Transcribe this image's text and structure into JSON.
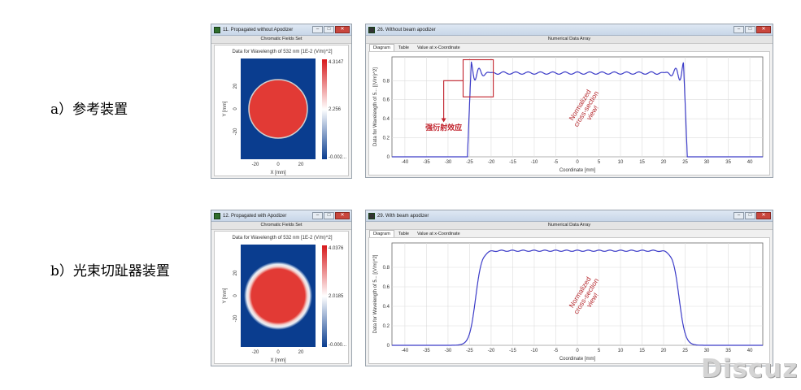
{
  "row_a": {
    "label": "a）参考装置",
    "field_window": {
      "title": "11. Propagated without Apodizer",
      "header": "Chromatic Fields Set",
      "caption": "Data for Wavelength of 532 nm  [1E-2 (V/m)^2]",
      "colorbar_max": "4.3147",
      "colorbar_mid": "2.256",
      "colorbar_min": "-0.002...",
      "xlabel": "X [mm]",
      "ylabel": "Y [mm]",
      "x_ticks": [
        "-20",
        "0",
        "20"
      ],
      "y_ticks": [
        "20",
        "0",
        "-20"
      ],
      "profile": "hard-edge"
    },
    "plot_window": {
      "title": "26. Without beam apodizer",
      "header": "Numerical Data Array",
      "tabs": [
        "Diagram",
        "Table",
        "Value at x-Coordinate"
      ],
      "ylabel": "Data for Wavelength of 5... [(V/m)^2]",
      "xlabel": "Coordinate [mm]",
      "annotation_text": "Normalized cross-section view!",
      "callout_label": "强衍射效应"
    }
  },
  "row_b": {
    "label": "b）光束切趾器装置",
    "field_window": {
      "title": "12. Propagated with Apodizer",
      "header": "Chromatic Fields Set",
      "caption": "Data for Wavelength of 532 nm  [1E-2 (V/m)^2]",
      "colorbar_max": "4.0376",
      "colorbar_mid": "2.0185",
      "colorbar_min": "-0.000...",
      "xlabel": "X [mm]",
      "ylabel": "Y [mm]",
      "x_ticks": [
        "-20",
        "0",
        "20"
      ],
      "y_ticks": [
        "20",
        "0",
        "-20"
      ],
      "profile": "soft-edge"
    },
    "plot_window": {
      "title": "29. With beam apodizer",
      "header": "Numerical Data Array",
      "tabs": [
        "Diagram",
        "Table",
        "Value at x-Coordinate"
      ],
      "ylabel": "Data for Wavelength of 5... [(V/m)^2]",
      "xlabel": "Coordinate [mm]",
      "annotation_text": "Normalized cross-section view!"
    }
  },
  "plot_axis": {
    "x_ticks": [
      "-40",
      "-35",
      "-30",
      "-25",
      "-20",
      "-15",
      "-10",
      "-5",
      "0",
      "5",
      "10",
      "15",
      "20",
      "25",
      "30",
      "35",
      "40"
    ],
    "y_ticks": [
      "0",
      "0.2",
      "0.4",
      "0.6",
      "0.8"
    ]
  },
  "watermark": "Discuz!",
  "colors": {
    "field_bg": "#0a3d8f",
    "field_spot": "#e23a35",
    "curve": "#3c3cc8",
    "callout": "#c0202a",
    "annotation": "#b5292e"
  }
}
